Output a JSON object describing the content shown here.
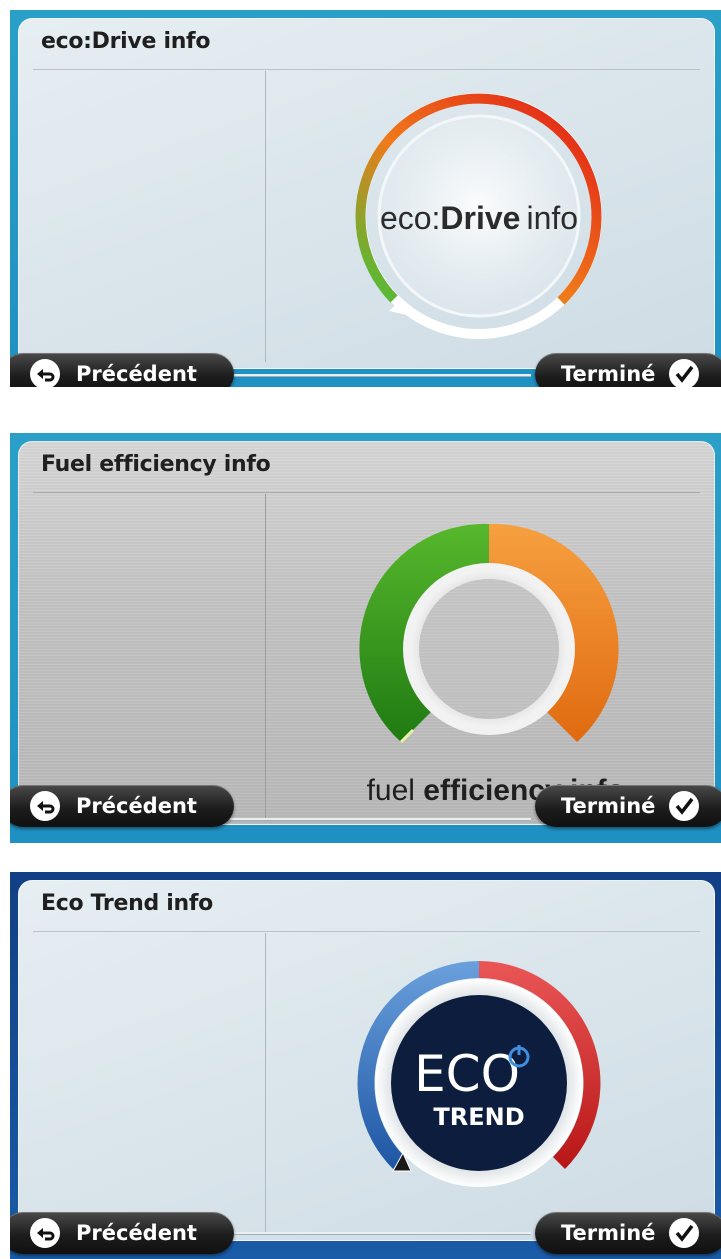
{
  "screens": [
    {
      "title": "eco:Drive info",
      "logo_text": {
        "prefix": "eco:",
        "brand": "Drive",
        "suffix": "info"
      },
      "back_label": "Précédent",
      "done_label": "Terminé"
    },
    {
      "title": "Fuel efficiency info",
      "logo_text": {
        "prefix": "fuel ",
        "brand": "efficiency info"
      },
      "back_label": "Précédent",
      "done_label": "Terminé"
    },
    {
      "title": "Eco Trend info",
      "logo_text": {
        "line1": "ECO",
        "line2": "TREND"
      },
      "back_label": "Précédent",
      "done_label": "Terminé"
    }
  ],
  "icons": {
    "back": "back-arrow-icon",
    "done": "checkmark-icon"
  },
  "colors": {
    "frame_blue": "#1f90c2",
    "frame_dark_blue": "#123f85",
    "gauge_green": "#3faa2a",
    "gauge_orange": "#f08a24",
    "gauge_red": "#d92020",
    "gauge_blue": "#3e78c0",
    "eco_disc": "#0d1d3d"
  }
}
